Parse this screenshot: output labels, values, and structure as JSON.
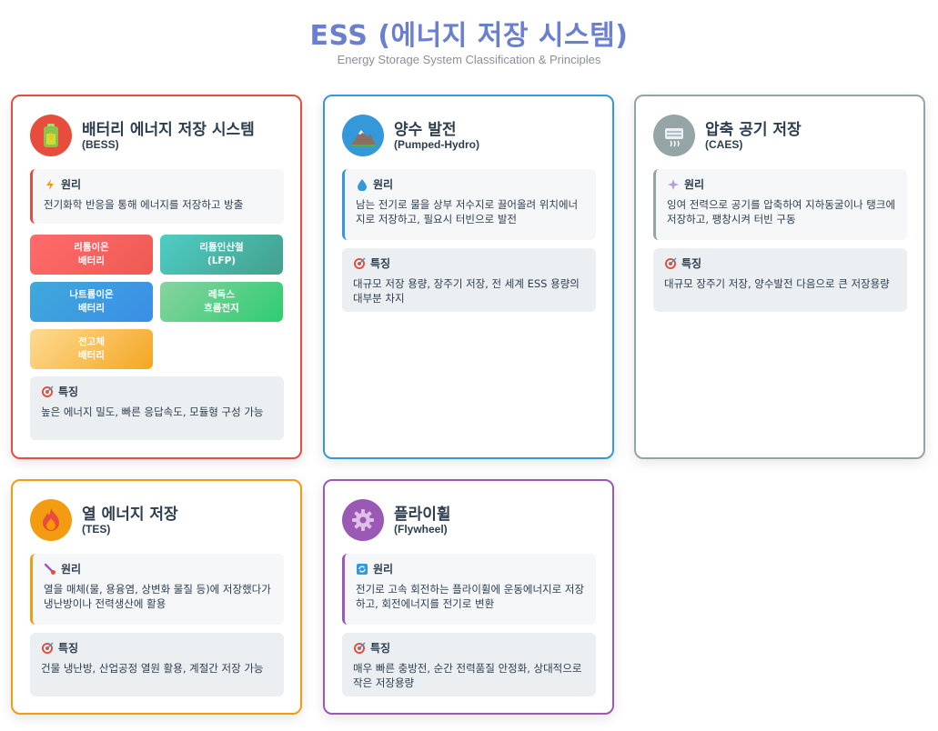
{
  "header": {
    "title": "ESS (에너지 저장 시스템)",
    "subtitle": "Energy Storage System Classification & Principles"
  },
  "labels": {
    "principle": "원리",
    "feature": "특징"
  },
  "cards": {
    "bess": {
      "title": "배터리 에너지 저장 시스템",
      "subtitle": "(BESS)",
      "icon": "battery-icon",
      "color": "#e74c3c",
      "principle": "전기화학 반응을 통해 에너지를 저장하고 방출",
      "types": [
        "리튬이온\n배터리",
        "리튬인산철\n(LFP)",
        "나트륨이온\n배터리",
        "레독스\n흐름전지",
        "전고체\n배터리"
      ],
      "feature": "높은 에너지 밀도, 빠른 응답속도, 모듈형 구성 가능"
    },
    "pumped_hydro": {
      "title": "양수 발전",
      "subtitle": "(Pumped-Hydro)",
      "icon": "mountain-icon",
      "color": "#3498db",
      "principle": "남는 전기로 물을 상부 저수지로 끌어올려 위치에너지로 저장하고, 필요시 터빈으로 발전",
      "feature": "대규모 저장 용량, 장주기 저장, 전 세계 ESS 용량의 대부분 차지"
    },
    "caes": {
      "title": "압축 공기 저장",
      "subtitle": "(CAES)",
      "icon": "air-compressor-icon",
      "color": "#95a5a6",
      "principle": "잉여 전력으로 공기를 압축하여 지하동굴이나 탱크에 저장하고, 팽창시켜 터빈 구동",
      "feature": "대규모 장주기 저장, 양수발전 다음으로 큰 저장용량"
    },
    "tes": {
      "title": "열 에너지 저장",
      "subtitle": "(TES)",
      "icon": "flame-icon",
      "color": "#f39c12",
      "principle": "열을 매체(물, 용융염, 상변화 물질 등)에 저장했다가 냉난방이나 전력생산에 활용",
      "feature": "건물 냉난방, 산업공정 열원 활용, 계절간 저장 가능"
    },
    "flywheel": {
      "title": "플라이휠",
      "subtitle": "(Flywheel)",
      "icon": "gear-icon",
      "color": "#9b59b6",
      "principle": "전기로 고속 회전하는 플라이휠에 운동에너지로 저장하고, 회전에너지를 전기로 변환",
      "feature": "매우 빠른 충방전, 순간 전력품질 안정화, 상대적으로 작은 저장용량"
    }
  }
}
